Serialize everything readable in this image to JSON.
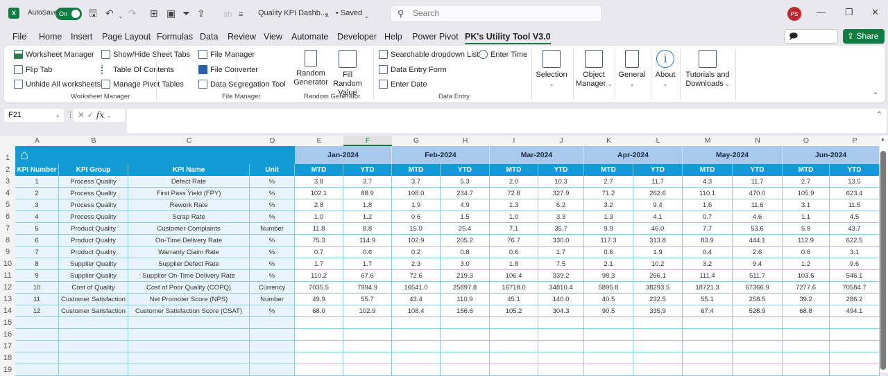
{
  "titlebar": {
    "autosave_label": "AutoSave",
    "autosave_state": "On",
    "doc_title": "Quality KPI Dashb...",
    "saved_label": "• Saved",
    "search_placeholder": "Search",
    "avatar_initials": "PS"
  },
  "menu": {
    "items": [
      "File",
      "Home",
      "Insert",
      "Page Layout",
      "Formulas",
      "Data",
      "Review",
      "View",
      "Automate",
      "Developer",
      "Help",
      "Power Pivot",
      "PK's Utility Tool V3.0"
    ],
    "active": "PK's Utility Tool V3.0",
    "comments_label": "Comments",
    "share_label": "Share"
  },
  "ribbon": {
    "worksheet_manager": {
      "label": "Worksheet Manager",
      "items": [
        "Worksheet Manager",
        "Flip Tab",
        "Unhide All worksheets",
        "Show/Hide Sheet Tabs",
        "Table Of Contents",
        "Manage Pivot Tables"
      ]
    },
    "file_manager": {
      "label": "File Manager",
      "items": [
        "File Manager",
        "File Converter",
        "Data Segregation Tool"
      ]
    },
    "random_generator": {
      "label": "Random Generator",
      "items": [
        "Random Generator",
        "Fill Random Value"
      ]
    },
    "data_entry": {
      "label": "Data Entry",
      "items": [
        "Searchable dropdown List",
        "Data Entry Form",
        "Enter Date",
        "Enter Time"
      ]
    },
    "large_buttons": [
      "Selection",
      "Object Manager",
      "General",
      "About",
      "Tutorials and Downloads"
    ]
  },
  "formula_bar": {
    "name_box": "F21",
    "formula": ""
  },
  "sheet": {
    "columns": [
      "A",
      "B",
      "C",
      "D",
      "E",
      "F",
      "G",
      "H",
      "I",
      "J",
      "K",
      "L",
      "M",
      "N",
      "O",
      "P"
    ],
    "selected_column": "F",
    "row_numbers": [
      "1",
      "2",
      "3",
      "4",
      "5",
      "6",
      "7",
      "8",
      "9",
      "10",
      "11",
      "12",
      "13",
      "14",
      "15",
      "16",
      "17",
      "18",
      "19"
    ],
    "months": [
      "Jan-2024",
      "Feb-2024",
      "Mar-2024",
      "Apr-2024",
      "May-2024",
      "Jun-2024"
    ],
    "headers": [
      "KPI Number",
      "KPI Group",
      "KPI Name",
      "Unit"
    ],
    "sub_headers": [
      "MTD",
      "YTD"
    ],
    "rows": [
      {
        "num": "1",
        "group": "Process Quality",
        "name": "Defect Rate",
        "unit": "%",
        "values": [
          "3.8",
          "3.7",
          "3.7",
          "5.3",
          "2.0",
          "10.3",
          "2.7",
          "11.7",
          "4.3",
          "11.7",
          "2.7",
          "13.5"
        ]
      },
      {
        "num": "2",
        "group": "Process Quality",
        "name": "First Pass Yield (FPY)",
        "unit": "%",
        "values": [
          "102.1",
          "88.9",
          "108.0",
          "234.7",
          "72.8",
          "327.9",
          "71.2",
          "262.6",
          "110.1",
          "470.0",
          "105.9",
          "623.4"
        ]
      },
      {
        "num": "3",
        "group": "Process Quality",
        "name": "Rework Rate",
        "unit": "%",
        "values": [
          "2.8",
          "1.8",
          "1.9",
          "4.9",
          "1.3",
          "6.2",
          "3.2",
          "9.4",
          "1.6",
          "11.6",
          "3.1",
          "11.5"
        ]
      },
      {
        "num": "4",
        "group": "Process Quality",
        "name": "Scrap Rate",
        "unit": "%",
        "values": [
          "1.0",
          "1.2",
          "0.6",
          "1.5",
          "1.0",
          "3.3",
          "1.3",
          "4.1",
          "0.7",
          "4.6",
          "1.1",
          "4.5"
        ]
      },
      {
        "num": "5",
        "group": "Product Quality",
        "name": "Customer Complaints",
        "unit": "Number",
        "values": [
          "11.8",
          "8.8",
          "15.0",
          "25.4",
          "7.1",
          "35.7",
          "9.9",
          "46.0",
          "7.7",
          "53.6",
          "5.9",
          "43.7"
        ]
      },
      {
        "num": "6",
        "group": "Product Quality",
        "name": "On-Time Delivery Rate",
        "unit": "%",
        "values": [
          "75.3",
          "114.9",
          "102.9",
          "205.2",
          "76.7",
          "330.0",
          "117.3",
          "313.8",
          "83.9",
          "444.1",
          "112.9",
          "622.5"
        ]
      },
      {
        "num": "7",
        "group": "Product Quality",
        "name": "Warranty Claim Rate",
        "unit": "%",
        "values": [
          "0.7",
          "0.6",
          "0.2",
          "0.8",
          "0.6",
          "1.7",
          "0.6",
          "1.9",
          "0.4",
          "2.6",
          "0.6",
          "3.1"
        ]
      },
      {
        "num": "8",
        "group": "Supplier Quality",
        "name": "Supplier Defect Rate",
        "unit": "%",
        "values": [
          "1.7",
          "1.7",
          "2.3",
          "3.0",
          "1.8",
          "7.5",
          "2.1",
          "10.2",
          "3.2",
          "9.4",
          "1.2",
          "9.6"
        ]
      },
      {
        "num": "9",
        "group": "Supplier Quality",
        "name": "Supplier On-Time Delivery Rate",
        "unit": "%",
        "values": [
          "110.2",
          "67.6",
          "72.6",
          "219.3",
          "106.4",
          "339.2",
          "98.3",
          "266.1",
          "111.4",
          "511.7",
          "103.6",
          "546.1"
        ]
      },
      {
        "num": "10",
        "group": "Cost of Quality",
        "name": "Cost of Poor Quality (COPQ)",
        "unit": "Currency",
        "values": [
          "7035.5",
          "7994.9",
          "16541.0",
          "25897.8",
          "16718.0",
          "34810.4",
          "5895.8",
          "38293.5",
          "18721.3",
          "67366.9",
          "7277.6",
          "70584.7"
        ]
      },
      {
        "num": "11",
        "group": "Customer Satisfaction",
        "name": "Net Promoter Score (NPS)",
        "unit": "Number",
        "values": [
          "49.9",
          "55.7",
          "43.4",
          "110.9",
          "45.1",
          "140.0",
          "40.5",
          "232.5",
          "55.1",
          "258.5",
          "39.2",
          "286.2"
        ]
      },
      {
        "num": "12",
        "group": "Customer Satisfaction",
        "name": "Customer Satisfaction Score (CSAT)",
        "unit": "%",
        "values": [
          "68.0",
          "102.9",
          "108.4",
          "156.6",
          "105.2",
          "304.3",
          "90.5",
          "335.9",
          "67.4",
          "528.9",
          "68.8",
          "494.1"
        ]
      }
    ]
  },
  "colors": {
    "header_blue": "#119ad4",
    "month_band": "#a6c9ec",
    "excel_green": "#107c41",
    "info_cell_bg": "#e8f4fb"
  }
}
